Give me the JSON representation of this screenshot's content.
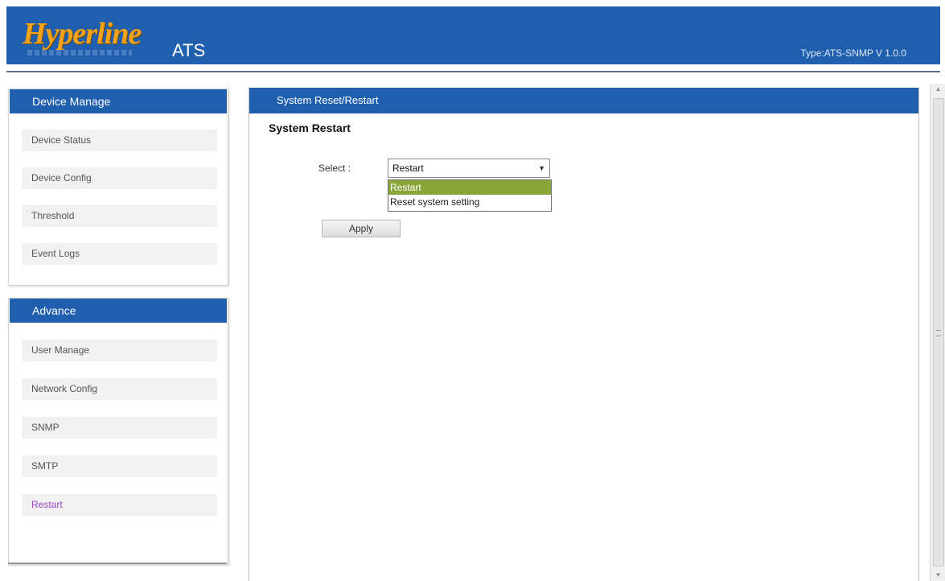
{
  "header": {
    "logo_text": "Hyperline",
    "app_name": "ATS",
    "type_label": "Type:ATS-SNMP V 1.0.0",
    "colors": {
      "bar": "#1f5fae",
      "logo": "#f2a21b"
    }
  },
  "sidebar": {
    "device_manage": {
      "title": "Device Manage",
      "items": [
        {
          "label": "Device Status"
        },
        {
          "label": "Device Config"
        },
        {
          "label": "Threshold"
        },
        {
          "label": "Event Logs"
        }
      ]
    },
    "advance": {
      "title": "Advance",
      "items": [
        {
          "label": "User Manage"
        },
        {
          "label": "Network Config"
        },
        {
          "label": "SNMP"
        },
        {
          "label": "SMTP"
        },
        {
          "label": "Restart",
          "active": true,
          "color": "#a045c8"
        }
      ]
    }
  },
  "main": {
    "header": "System Reset/Restart",
    "section_title": "System Restart",
    "select_label": "Select :",
    "select_value": "Restart",
    "dropdown_options": [
      {
        "label": "Restart",
        "highlighted": true,
        "color": "#8aa63b"
      },
      {
        "label": "Reset system setting",
        "highlighted": false
      }
    ],
    "apply_label": "Apply"
  },
  "scrollbar": {
    "up_icon": "scroll-up-arrow-icon",
    "down_icon": "scroll-down-arrow-icon"
  }
}
